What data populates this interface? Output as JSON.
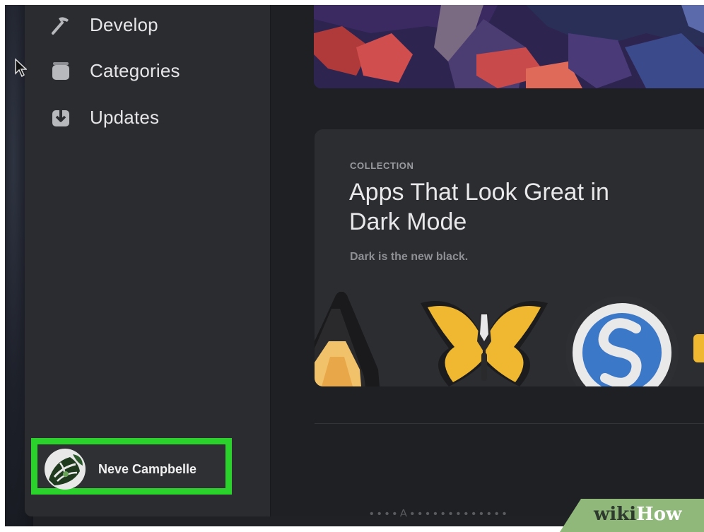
{
  "sidebar": {
    "items": [
      {
        "label": "Develop",
        "icon": "hammer-icon"
      },
      {
        "label": "Categories",
        "icon": "categories-icon"
      },
      {
        "label": "Updates",
        "icon": "updates-icon"
      }
    ],
    "user": {
      "name": "Neve Campbelle",
      "highlight_color": "#2bd22b"
    }
  },
  "main": {
    "card": {
      "eyebrow": "COLLECTION",
      "title": "Apps That Look Great in Dark Mode",
      "subtitle": "Dark is the new black."
    },
    "footer_text": "• • • •   A • • • •   • • • • • • • • •"
  },
  "watermark": {
    "part1": "wiki",
    "part2": "How"
  }
}
